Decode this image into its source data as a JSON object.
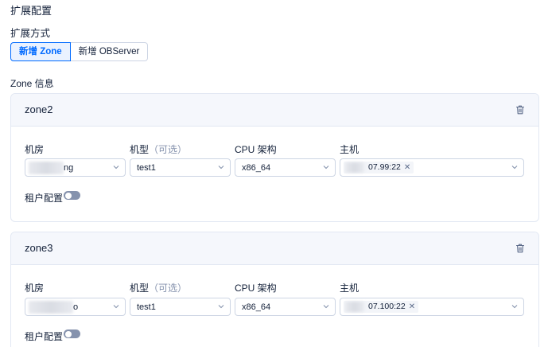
{
  "page": {
    "title": "扩展配置",
    "extension_mode_label": "扩展方式",
    "mode_options": [
      "新增 Zone",
      "新增 OBServer"
    ],
    "selected_mode": "新增 Zone",
    "zone_info_label": "Zone 信息"
  },
  "zones": [
    {
      "name": "zone2",
      "labels": {
        "idc": "机房",
        "model": "机型",
        "model_hint": "（可选）",
        "cpu": "CPU 架构",
        "host": "主机",
        "tenant_config": "租户配置"
      },
      "idc_value": "ng",
      "model_value": "test1",
      "cpu_value": "x86_64",
      "host_tag": "07.99:22",
      "tenant_config_enabled": false
    },
    {
      "name": "zone3",
      "labels": {
        "idc": "机房",
        "model": "机型",
        "model_hint": "（可选）",
        "cpu": "CPU 架构",
        "host": "主机",
        "tenant_config": "租户配置"
      },
      "idc_value": "o",
      "model_value": "test1",
      "cpu_value": "x86_64",
      "host_tag": "07.100:22",
      "tenant_config_enabled": false
    }
  ],
  "colors": {
    "accent": "#006aff",
    "text": "#132039",
    "hint": "#8592ad",
    "border": "#cdd5e4",
    "card_header_bg": "#f5f7fc",
    "switch_off": "#8592ad"
  },
  "icons": {
    "delete": "trash-icon",
    "dropdown": "chevron-down-icon",
    "tag_remove": "close-icon"
  }
}
